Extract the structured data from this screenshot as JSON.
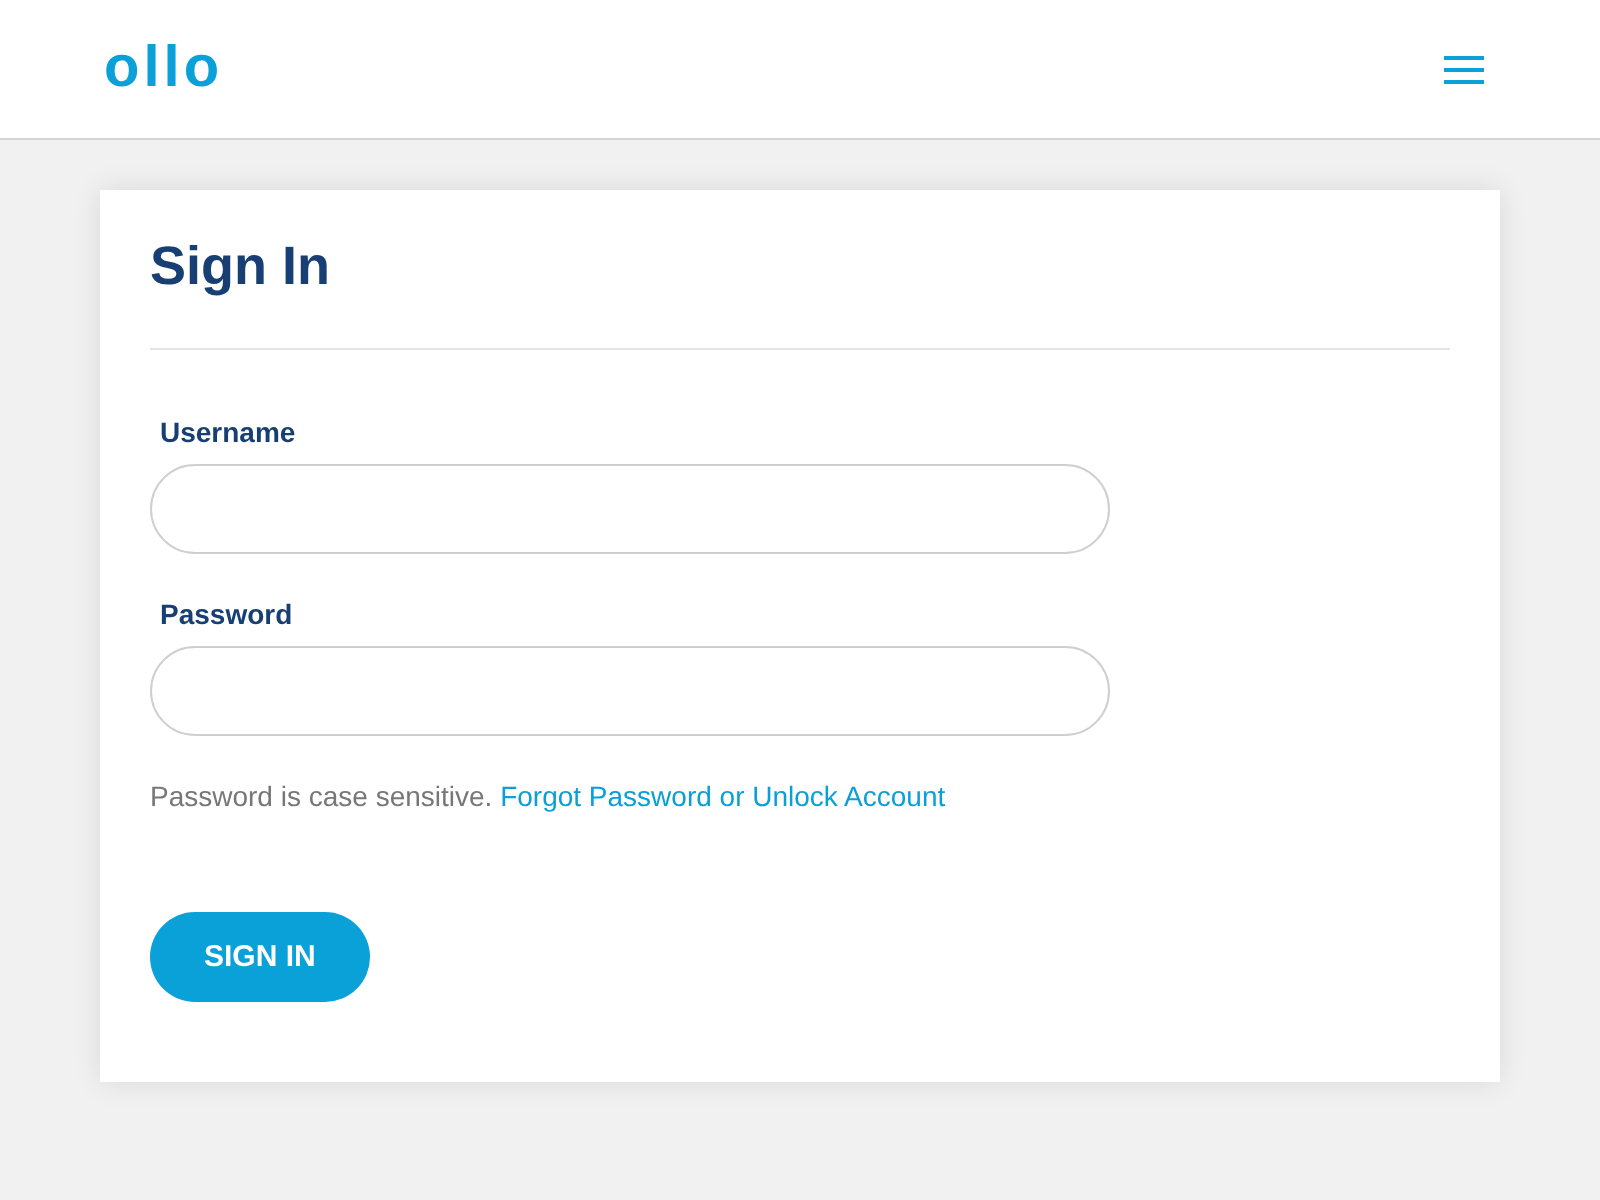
{
  "header": {
    "logo": "ollo"
  },
  "form": {
    "title": "Sign In",
    "fields": [
      {
        "label": "Username"
      },
      {
        "label": "Password"
      }
    ],
    "hint": "Password is case sensitive.",
    "link": "Forgot Password or Unlock Account",
    "button": "SIGN IN"
  }
}
